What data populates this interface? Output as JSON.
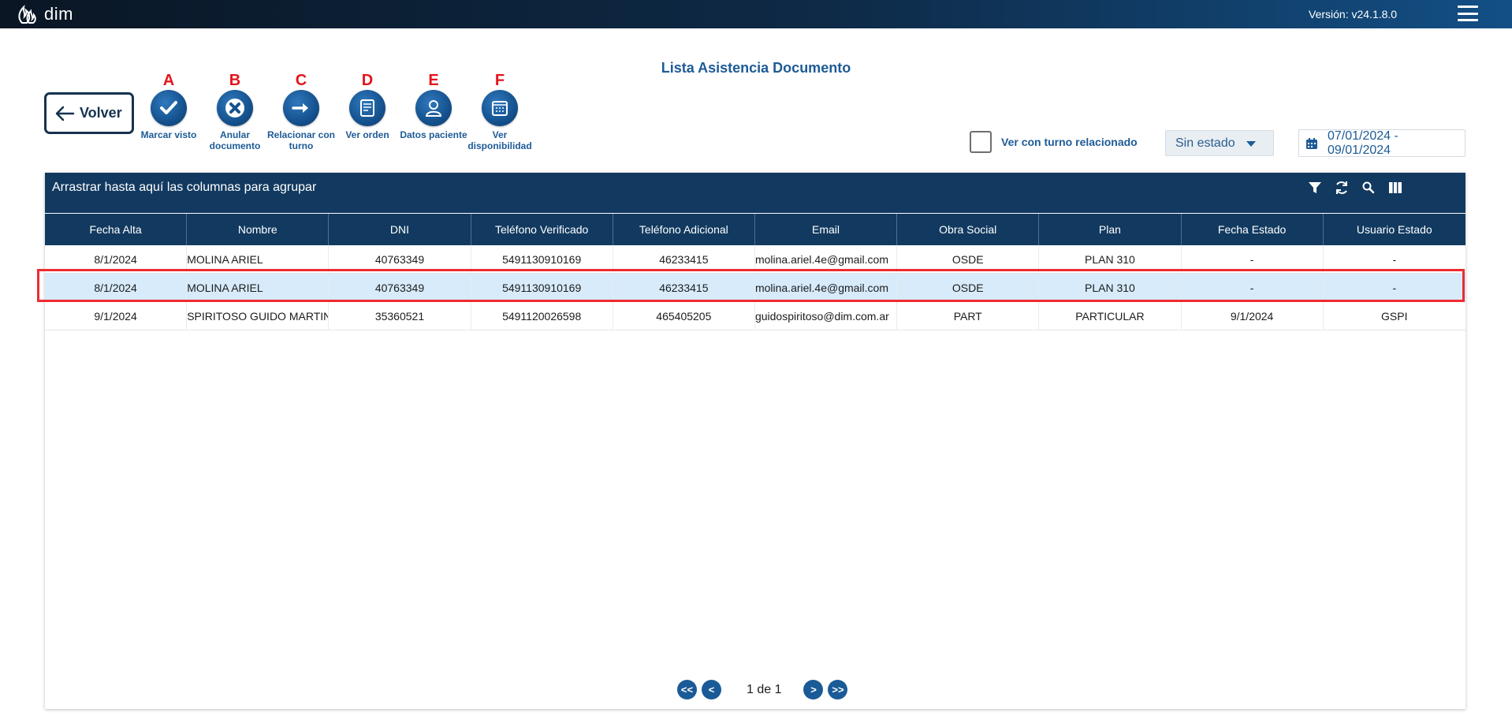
{
  "app": {
    "logo_text": "dim",
    "version": "Versión: v24.1.8.0"
  },
  "page": {
    "title": "Lista Asistencia Documento"
  },
  "back_button": {
    "label": "Volver"
  },
  "actions": [
    {
      "letter": "A",
      "caption": "Marcar visto",
      "icon": "check-icon"
    },
    {
      "letter": "B",
      "caption": "Anular documento",
      "icon": "x-icon"
    },
    {
      "letter": "C",
      "caption": "Relacionar con turno",
      "icon": "arrow-right-icon"
    },
    {
      "letter": "D",
      "caption": "Ver orden",
      "icon": "document-icon"
    },
    {
      "letter": "E",
      "caption": "Datos paciente",
      "icon": "user-icon"
    },
    {
      "letter": "F",
      "caption": "Ver disponibilidad",
      "icon": "calendar-icon"
    }
  ],
  "filters": {
    "related_checkbox_label": "Ver con turno relacionado",
    "related_checked": false,
    "state_select": "Sin estado",
    "date_range": "07/01/2024 - 09/01/2024"
  },
  "grid": {
    "group_hint": "Arrastrar hasta aquí las columnas para agrupar",
    "tools": [
      "filter-icon",
      "refresh-icon",
      "search-icon",
      "columns-icon"
    ],
    "columns": [
      "Fecha Alta",
      "Nombre",
      "DNI",
      "Teléfono Verificado",
      "Teléfono Adicional",
      "Email",
      "Obra Social",
      "Plan",
      "Fecha Estado",
      "Usuario Estado"
    ],
    "rows": [
      [
        "8/1/2024",
        "MOLINA ARIEL",
        "40763349",
        "5491130910169",
        "46233415",
        "molina.ariel.4e@gmail.com",
        "OSDE",
        "PLAN 310",
        "-",
        "-"
      ],
      [
        "8/1/2024",
        "MOLINA ARIEL",
        "40763349",
        "5491130910169",
        "46233415",
        "molina.ariel.4e@gmail.com",
        "OSDE",
        "PLAN 310",
        "-",
        "-"
      ],
      [
        "9/1/2024",
        "SPIRITOSO GUIDO MARTIN",
        "35360521",
        "5491120026598",
        "465405205",
        "guidospiritoso@dim.com.ar",
        "PART",
        "PARTICULAR",
        "9/1/2024",
        "GSPI"
      ]
    ],
    "selected_row": 1
  },
  "pagination": {
    "first": "<<",
    "prev": "<",
    "info": "1 de 1",
    "next": ">",
    "last": ">>"
  },
  "colors": {
    "accent": "#1d5b96",
    "header_bg": "#123a60",
    "highlight": "#ee2b32",
    "selected_row": "#d7ebfb",
    "letter_red": "#e3141c"
  }
}
